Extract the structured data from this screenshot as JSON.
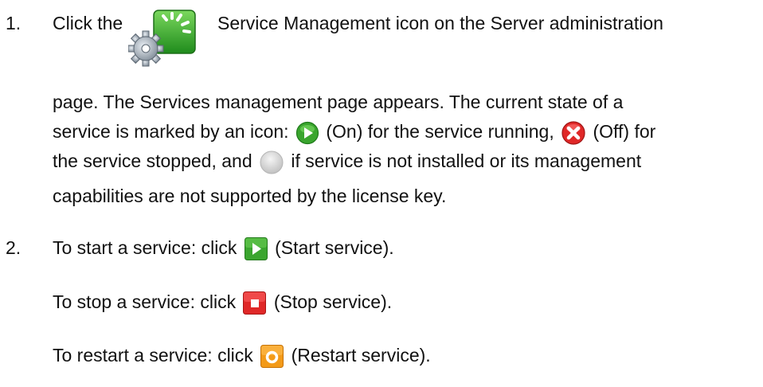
{
  "step1": {
    "number": "1.",
    "intro_before": "Click the",
    "intro_after": "Service Management icon on the Server administration",
    "line2": "page. The Services management page appears. The current state of a",
    "line3_before": "service is marked by an icon:",
    "on_label": "(On) for the service running,",
    "off_label": "(Off) for",
    "line4_before": "the service stopped, and",
    "line4_after": "if service is not installed or its management",
    "line5": "capabilities are not supported by the license key."
  },
  "step2": {
    "number": "2.",
    "start_before": "To start a service: click",
    "start_after": "(Start service).",
    "stop_before": "To stop a service: click",
    "stop_after": "(Stop service).",
    "restart_before": "To restart a service: click",
    "restart_after": "(Restart service)."
  },
  "icons": {
    "service_management": "service-management-icon",
    "status_on": "status-on-icon",
    "status_off": "status-off-icon",
    "status_not_installed": "status-not-installed-icon",
    "start": "start-service-icon",
    "stop": "stop-service-icon",
    "restart": "restart-service-icon"
  },
  "colors": {
    "green": "#3aa52e",
    "red": "#e02828",
    "orange": "#f39a18",
    "gray": "#d9d9d9"
  }
}
